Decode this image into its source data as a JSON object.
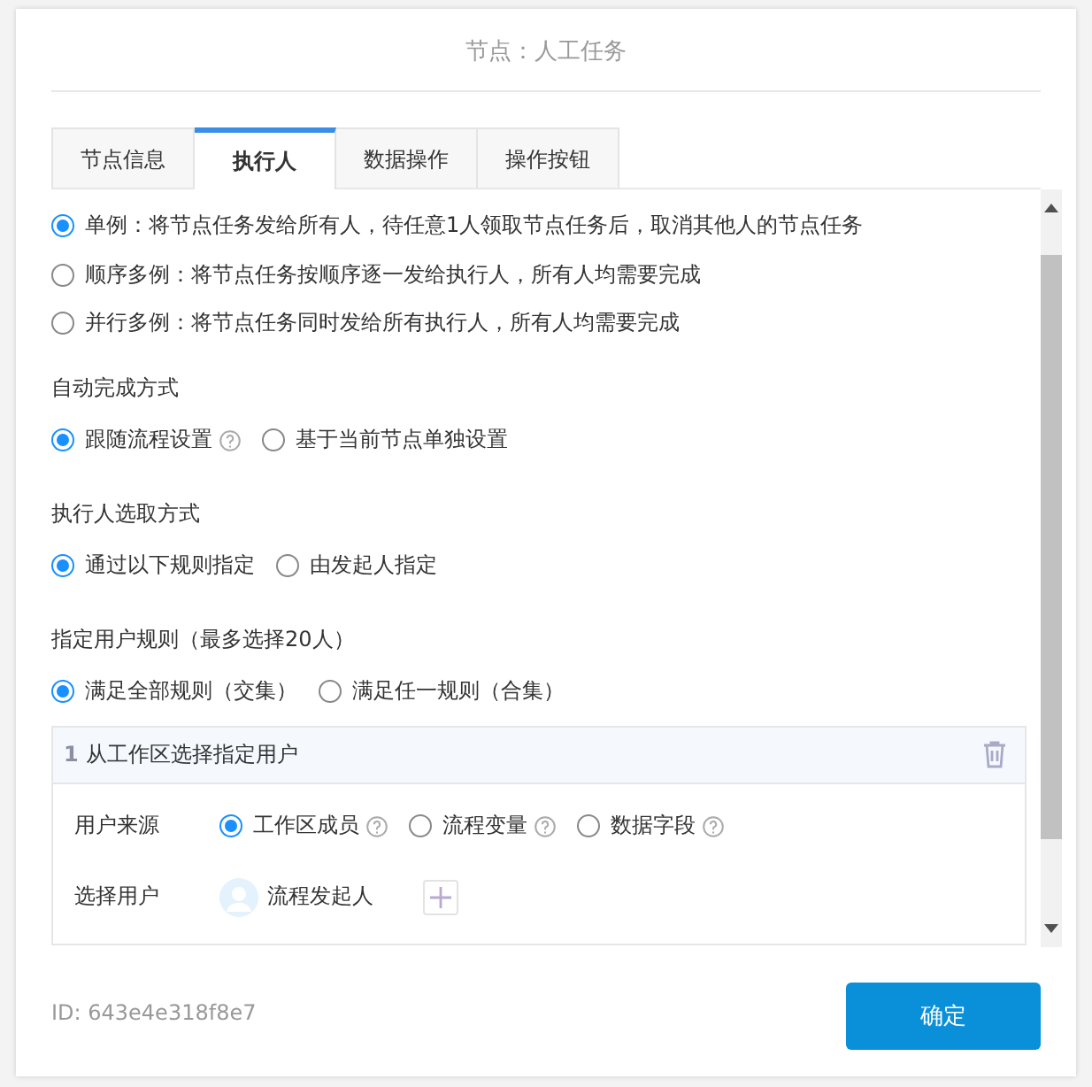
{
  "dialog": {
    "title": "节点：人工任务"
  },
  "tabs": [
    {
      "label": "节点信息",
      "selected": false
    },
    {
      "label": "执行人",
      "selected": true
    },
    {
      "label": "数据操作",
      "selected": false
    },
    {
      "label": "操作按钮",
      "selected": false
    }
  ],
  "instance_mode": [
    {
      "label": "单例：将节点任务发给所有人，待任意1人领取节点任务后，取消其他人的节点任务",
      "selected": true
    },
    {
      "label": "顺序多例：将节点任务按顺序逐一发给执行人，所有人均需要完成",
      "selected": false
    },
    {
      "label": "并行多例：将节点任务同时发给所有执行人，所有人均需要完成",
      "selected": false
    }
  ],
  "groups": [
    {
      "heading": "自动完成方式",
      "options": [
        {
          "label": "跟随流程设置",
          "help": true,
          "selected": true
        },
        {
          "label": "基于当前节点单独设置",
          "help": false,
          "selected": false
        }
      ]
    },
    {
      "heading": "执行人选取方式",
      "options": [
        {
          "label": "通过以下规则指定",
          "help": false,
          "selected": true
        },
        {
          "label": "由发起人指定",
          "help": false,
          "selected": false
        }
      ]
    },
    {
      "heading": "指定用户规则（最多选择20人）",
      "options": [
        {
          "label": "满足全部规则（交集）",
          "help": false,
          "selected": true
        },
        {
          "label": "满足任一规则（合集）",
          "help": false,
          "selected": false
        }
      ]
    }
  ],
  "rule_card": {
    "index": "1",
    "title": "从工作区选择指定用户",
    "fields": [
      {
        "kind": "radio",
        "label": "用户来源",
        "options": [
          {
            "label": "工作区成员",
            "help": true,
            "selected": true
          },
          {
            "label": "流程变量",
            "help": true,
            "selected": false
          },
          {
            "label": "数据字段",
            "help": true,
            "selected": false
          }
        ]
      },
      {
        "kind": "users",
        "label": "选择用户",
        "users": [
          "流程发起人"
        ]
      }
    ]
  },
  "footer": {
    "id_text": "ID: 643e4e318f8e7",
    "confirm_button": "确定"
  }
}
